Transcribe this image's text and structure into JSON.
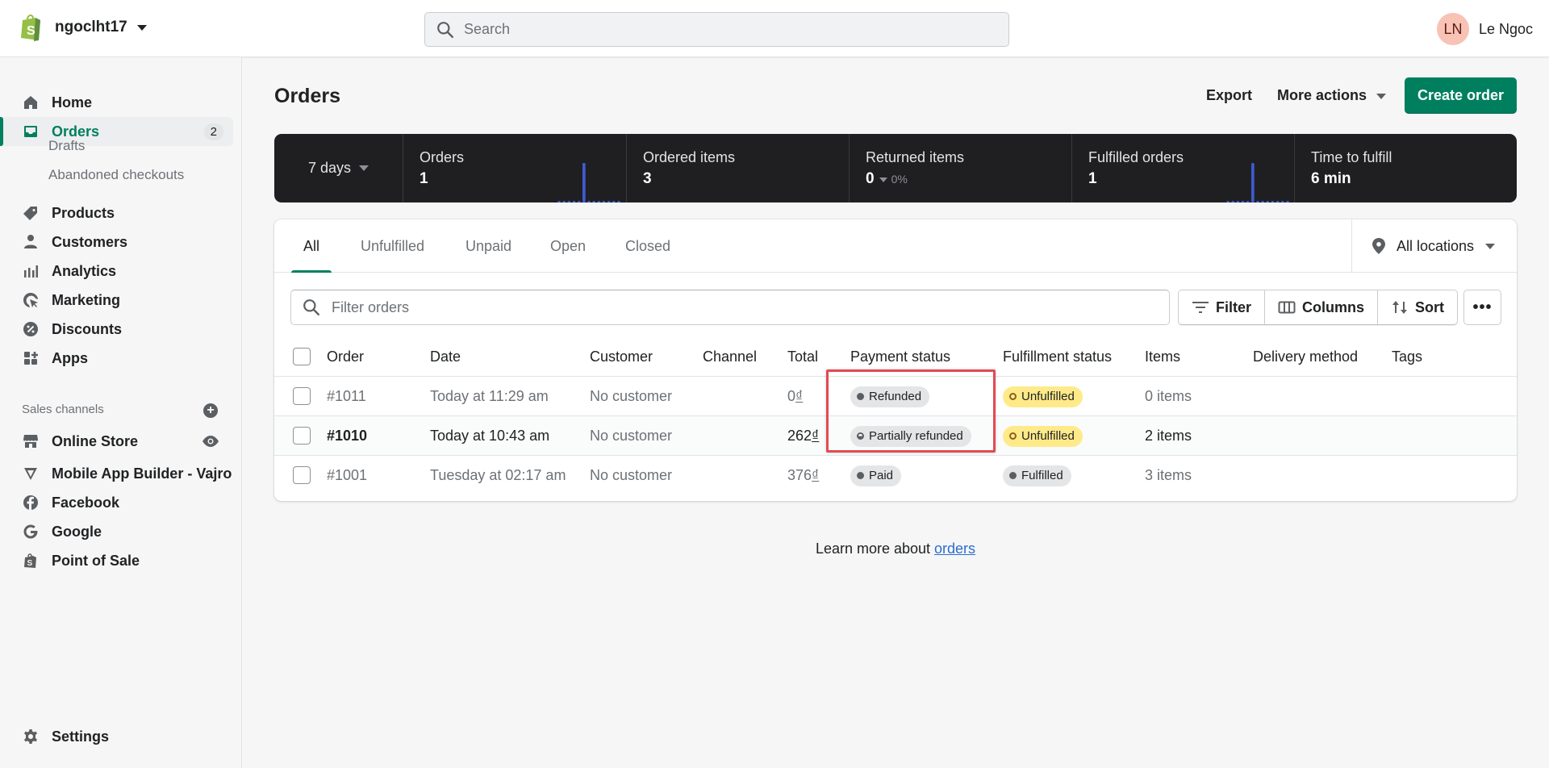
{
  "topbar": {
    "store_name": "ngoclht17",
    "search_placeholder": "Search",
    "user_initials": "LN",
    "user_name": "Le Ngoc"
  },
  "sidebar": {
    "items": [
      {
        "label": "Home",
        "icon": "home-icon"
      },
      {
        "label": "Orders",
        "icon": "orders-inbox-icon",
        "badge": "2",
        "active": true
      },
      {
        "label": "Products",
        "icon": "tag-icon"
      },
      {
        "label": "Customers",
        "icon": "person-icon"
      },
      {
        "label": "Analytics",
        "icon": "bar-chart-icon"
      },
      {
        "label": "Marketing",
        "icon": "target-cursor-icon"
      },
      {
        "label": "Discounts",
        "icon": "discount-badge-icon"
      },
      {
        "label": "Apps",
        "icon": "apps-grid-icon"
      }
    ],
    "orders_subitems": [
      "Drafts",
      "Abandoned checkouts"
    ],
    "sales_channels_label": "Sales channels",
    "channels": [
      {
        "label": "Online Store",
        "icon": "storefront-icon"
      },
      {
        "label": "Mobile App Builder - Vajro",
        "icon": "vajro-icon"
      },
      {
        "label": "Facebook",
        "icon": "facebook-icon"
      },
      {
        "label": "Google",
        "icon": "google-icon"
      },
      {
        "label": "Point of Sale",
        "icon": "pos-bag-icon"
      }
    ],
    "settings_label": "Settings"
  },
  "header": {
    "title": "Orders",
    "export_label": "Export",
    "more_actions_label": "More actions",
    "create_label": "Create order"
  },
  "stats": {
    "range_label": "7 days",
    "items": [
      {
        "label": "Orders",
        "value": "1",
        "sparkline": [
          0,
          0,
          0,
          0,
          0,
          1,
          0,
          0,
          0,
          0,
          0,
          0,
          0
        ]
      },
      {
        "label": "Ordered items",
        "value": "3"
      },
      {
        "label": "Returned items",
        "value": "0",
        "delta": "0%"
      },
      {
        "label": "Fulfilled orders",
        "value": "1",
        "sparkline": [
          0,
          0,
          0,
          0,
          0,
          1,
          0,
          0,
          0,
          0,
          0,
          0,
          0
        ]
      },
      {
        "label": "Time to fulfill",
        "value": "6 min"
      }
    ],
    "accent_color": "#3f5bd0"
  },
  "orders_card": {
    "tabs": [
      "All",
      "Unfulfilled",
      "Unpaid",
      "Open",
      "Closed"
    ],
    "active_tab": "All",
    "location_label": "All locations",
    "filter_placeholder": "Filter orders",
    "filter_label": "Filter",
    "columns_label": "Columns",
    "sort_label": "Sort",
    "columns": [
      "Order",
      "Date",
      "Customer",
      "Channel",
      "Total",
      "Payment status",
      "Fulfillment status",
      "Items",
      "Delivery method",
      "Tags"
    ],
    "rows": [
      {
        "order": "#1011",
        "date": "Today at 11:29 am",
        "customer": "No customer",
        "channel": "",
        "total_amount": "0",
        "currency": "₫",
        "payment_status": "Refunded",
        "fulfillment_status": "Unfulfilled",
        "items": "0 items",
        "delivery": "",
        "tags": "",
        "unread": false
      },
      {
        "order": "#1010",
        "date": "Today at 10:43 am",
        "customer": "No customer",
        "channel": "",
        "total_amount": "262",
        "currency": "₫",
        "payment_status": "Partially refunded",
        "fulfillment_status": "Unfulfilled",
        "items": "2 items",
        "delivery": "",
        "tags": "",
        "unread": true
      },
      {
        "order": "#1001",
        "date": "Tuesday at 02:17 am",
        "customer": "No customer",
        "channel": "",
        "total_amount": "376",
        "currency": "₫",
        "payment_status": "Paid",
        "fulfillment_status": "Fulfilled",
        "items": "3 items",
        "delivery": "",
        "tags": "",
        "unread": false
      }
    ]
  },
  "footer": {
    "learn_prefix": "Learn more about ",
    "learn_link": "orders"
  },
  "colors": {
    "primary_green": "#007f5f",
    "link_blue": "#2c6ecb",
    "highlight_red": "#e24a52",
    "unfulfilled_yellow": "#ffea8a"
  }
}
